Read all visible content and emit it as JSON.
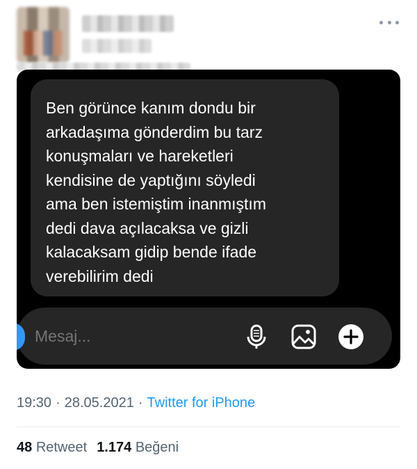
{
  "message": {
    "text": "Ben görünce kanım dondu bir\narkadaşıma gönderdim bu tarz\nkonuşmaları ve hareketleri\nkendisine de yaptığını söyledi\nama ben istemiştim inanmıştım\ndedi dava açılacaksa ve gizli\nkalacaksam gidip bende ifade\nverebilirim dedi"
  },
  "composer": {
    "placeholder": "Mesaj..."
  },
  "tweet_meta": {
    "time": "19:30",
    "date": "28.05.2021",
    "separator": "·",
    "source": "Twitter for iPhone"
  },
  "stats": {
    "retweets_count": "48",
    "retweets_label": "Retweet",
    "likes_count": "1.174",
    "likes_label": "Beğeni"
  },
  "icons": {
    "more": "more-horizontal-icon",
    "mic": "microphone-icon",
    "image": "image-icon",
    "plus": "plus-circle-icon"
  },
  "colors": {
    "card_background": "#000000",
    "bubble_background": "#262626",
    "link_blue": "#1d9bf0",
    "meta_gray": "#536471"
  }
}
